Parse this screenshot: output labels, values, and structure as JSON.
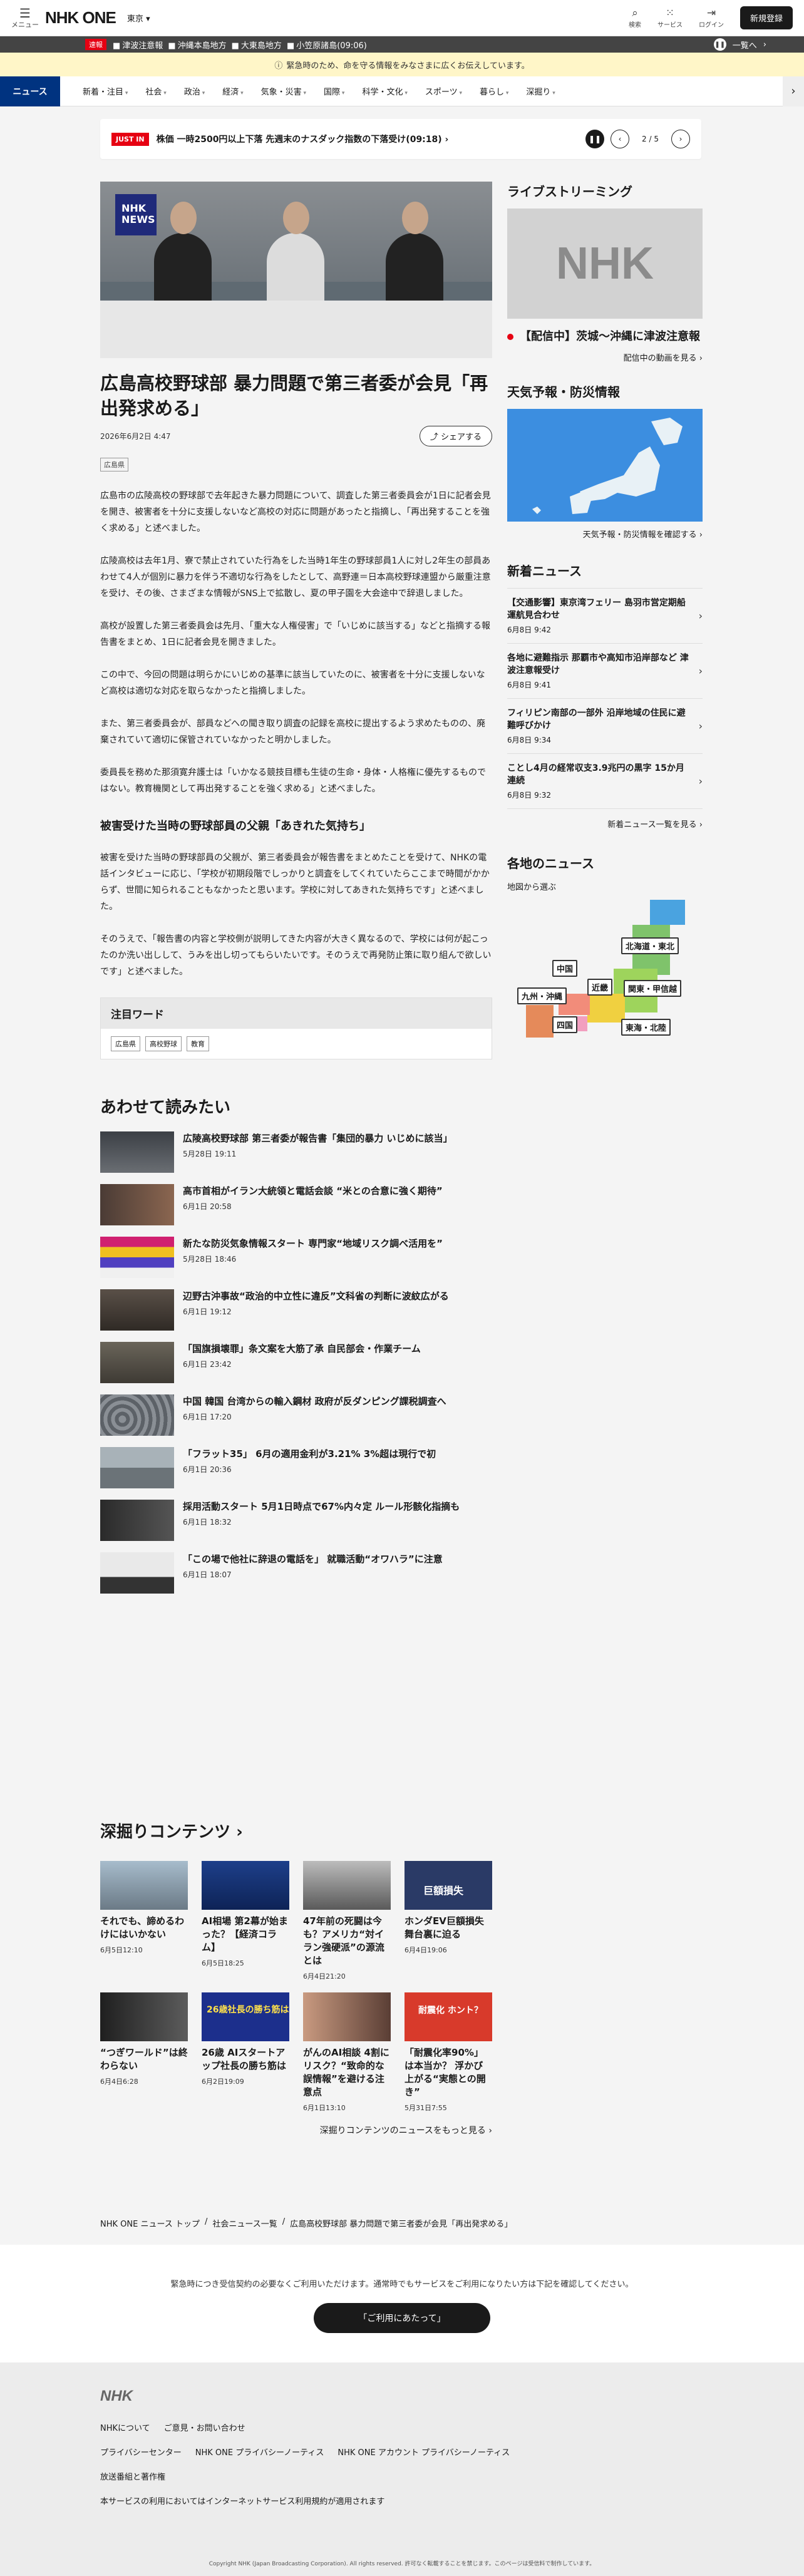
{
  "header": {
    "menu_label": "メニュー",
    "logo": "NHK ONE",
    "region": "東京",
    "search_label": "検索",
    "service_label": "サービス",
    "login_label": "ログイン",
    "signup": "新規登録"
  },
  "ticker": {
    "tag": "速報",
    "items": [
      "津波注意報",
      "沖縄本島地方",
      "大東島地方",
      "小笠原諸島(09:06)"
    ],
    "list_label": "一覧へ"
  },
  "alert": "緊急時のため、命を守る情報をみなさまに広くお伝えしています。",
  "nav": {
    "home": "ニュース",
    "items": [
      "新着・注目",
      "社会",
      "政治",
      "経済",
      "気象・災害",
      "国際",
      "科学・文化",
      "スポーツ",
      "暮らし",
      "深掘り"
    ]
  },
  "breaking": {
    "tag": "JUST IN",
    "text": "株価 一時2500円以上下落 先週末のナスダック指数の下落受け(09:18)",
    "page": "2 / 5"
  },
  "article": {
    "title": "広島高校野球部 暴力問題で第三者委が会見「再出発求める」",
    "date": "2026年6月2日 4:47",
    "share": "シェアする",
    "tag": "広島県",
    "paragraphs": [
      "広島市の広陵高校の野球部で去年起きた暴力問題について、調査した第三者委員会が1日に記者会見を開き、被害者を十分に支援しないなど高校の対応に問題があったと指摘し、「再出発することを強く求める」と述べました。",
      "広陵高校は去年1月、寮で禁止されていた行為をした当時1年生の野球部員1人に対し2年生の部員あわせて4人が個別に暴力を伴う不適切な行為をしたとして、高野連＝日本高校野球連盟から厳重注意を受け、その後、さまざまな情報がSNS上で拡散し、夏の甲子園を大会途中で辞退しました。",
      "高校が設置した第三者委員会は先月、「重大な人権侵害」で「いじめに該当する」などと指摘する報告書をまとめ、1日に記者会見を開きました。",
      "この中で、今回の問題は明らかにいじめの基準に該当していたのに、被害者を十分に支援しないなど高校は適切な対応を取らなかったと指摘しました。",
      "また、第三者委員会が、部員などへの聞き取り調査の記録を高校に提出するよう求めたものの、廃棄されていて適切に保管されていなかったと明かしました。",
      "委員長を務めた那須寛弁護士は「いかなる競技目標も生徒の生命・身体・人格権に優先するものではない。教育機関として再出発することを強く求める」と述べました。"
    ],
    "subhead": "被害受けた当時の野球部員の父親「あきれた気持ち」",
    "paragraphs2": [
      "被害を受けた当時の野球部員の父親が、第三者委員会が報告書をまとめたことを受けて、NHKの電話インタビューに応じ、「学校が初期段階でしっかりと調査をしてくれていたらここまで時間がかからず、世間に知られることもなかったと思います。学校に対してあきれた気持ちです」と述べました。",
      "そのうえで、「報告書の内容と学校側が説明してきた内容が大きく異なるので、学校には何が起こったのか洗い出しして、うみを出し切ってもらいたいです。そのうえで再発防止策に取り組んで欲しいです」と述べました。"
    ]
  },
  "keywords": {
    "title": "注目ワード",
    "items": [
      "広島県",
      "高校野球",
      "教育"
    ]
  },
  "related": {
    "title": "あわせて読みたい",
    "items": [
      {
        "title": "広陵高校野球部 第三者委が報告書「集団的暴力 いじめに該当」",
        "date": "5月28日 19:11"
      },
      {
        "title": "高市首相がイラン大統領と電話会談 “米との合意に強く期待”",
        "date": "6月1日 20:58"
      },
      {
        "title": "新たな防災気象情報スタート 専門家“地域リスク調べ活用を”",
        "date": "5月28日 18:46"
      },
      {
        "title": "辺野古沖事故“政治的中立性に違反”文科省の判断に波紋広がる",
        "date": "6月1日 19:12"
      },
      {
        "title": "「国旗損壊罪」条文案を大筋了承 自民部会・作業チーム",
        "date": "6月1日 23:42"
      },
      {
        "title": "中国 韓国 台湾からの輸入鋼材 政府が反ダンピング課税調査へ",
        "date": "6月1日 17:20"
      },
      {
        "title": "「フラット35」 6月の適用金利が3.21% 3%超は現行で初",
        "date": "6月1日 20:36"
      },
      {
        "title": "採用活動スタート 5月1日時点で67%内々定 ルール形骸化指摘も",
        "date": "6月1日 18:32"
      },
      {
        "title": "「この場で他社に辞退の電話を」 就職活動“オワハラ”に注意",
        "date": "6月1日 18:07"
      }
    ]
  },
  "deep": {
    "title": "深掘りコンテンツ",
    "more": "深掘りコンテンツのニュースをもっと見る",
    "items": [
      {
        "title": "それでも、諦めるわけにはいかない",
        "date": "6月5日12:10"
      },
      {
        "title": "AI相場 第2幕が始まった？【経済コラム】",
        "date": "6月5日18:25"
      },
      {
        "title": "47年前の死闘は今も？アメリカ“対イラン強硬派”の源流とは",
        "date": "6月4日21:20"
      },
      {
        "title": "ホンダEV巨額損失 舞台裏に迫る",
        "date": "6月4日19:06"
      },
      {
        "title": "“つぎワールド”は終わらない",
        "date": "6月4日6:28"
      },
      {
        "title": "26歳 AIスタートアップ社長の勝ち筋は",
        "date": "6月2日19:09"
      },
      {
        "title": "がんのAI相談 4割にリスク？“致命的な誤情報”を避ける注意点",
        "date": "6月1日13:10"
      },
      {
        "title": "「耐震化率90%」は本当か？ 浮かび上がる“実態との開き”",
        "date": "5月31日7:55"
      }
    ],
    "thumb_text": [
      "",
      "",
      "",
      "巨額損失",
      "",
      "26歳社長の勝ち筋は",
      "",
      "耐震化 ホント？"
    ]
  },
  "sidebar": {
    "live_title": "ライブストリーミング",
    "live_logo": "NHK",
    "live_item": "【配信中】茨城～沖縄に津波注意報",
    "live_more": "配信中の動画を見る",
    "weather_title": "天気予報・防災情報",
    "weather_more": "天気予報・防災情報を確認する",
    "latest_title": "新着ニュース",
    "latest": [
      {
        "title": "【交通影響】東京湾フェリー 島羽市営定期船 運航見合わせ",
        "date": "6月8日 9:42"
      },
      {
        "title": "各地に避難指示 那覇市や高知市沿岸部など 津波注意報受け",
        "date": "6月8日 9:41"
      },
      {
        "title": "フィリピン南部の一部外 沿岸地域の住民に避難呼びかけ",
        "date": "6月8日 9:34"
      },
      {
        "title": "ことし4月の経常収支3.9兆円の黒字 15か月連続",
        "date": "6月8日 9:32"
      }
    ],
    "latest_more": "新着ニュース一覧を見る",
    "local_title": "各地のニュース",
    "local_link": "地図から選ぶ",
    "regions": [
      "北海道・東北",
      "関東・甲信越",
      "東海・北陸",
      "近畿",
      "中国",
      "四国",
      "九州・沖縄"
    ]
  },
  "breadcrumb": [
    "NHK ONE ニュース トップ",
    "社会ニュース一覧",
    "広島高校野球部 暴力問題で第三者委が会見「再出発求める」"
  ],
  "notice": {
    "text": "緊急時につき受信契約の必要なくご利用いただけます。通常時でもサービスをご利用になりたい方は下記を確認してください。",
    "button": "「ご利用にあたって」"
  },
  "footer": {
    "logo": "NHK",
    "row1": [
      "NHKについて",
      "ご意見・お問い合わせ"
    ],
    "row2": [
      "プライバシーセンター",
      "NHK ONE プライバシーノーティス",
      "NHK ONE アカウント プライバシーノーティス"
    ],
    "row3": [
      "放送番組と著作権"
    ],
    "row4": [
      "本サービスの利用においてはインターネットサービス利用規約が適用されます"
    ],
    "copyright": "Copyright NHK (Japan Broadcasting Corporation). All rights reserved. 許可なく転載することを禁じます。このページは受信料で制作しています。"
  }
}
